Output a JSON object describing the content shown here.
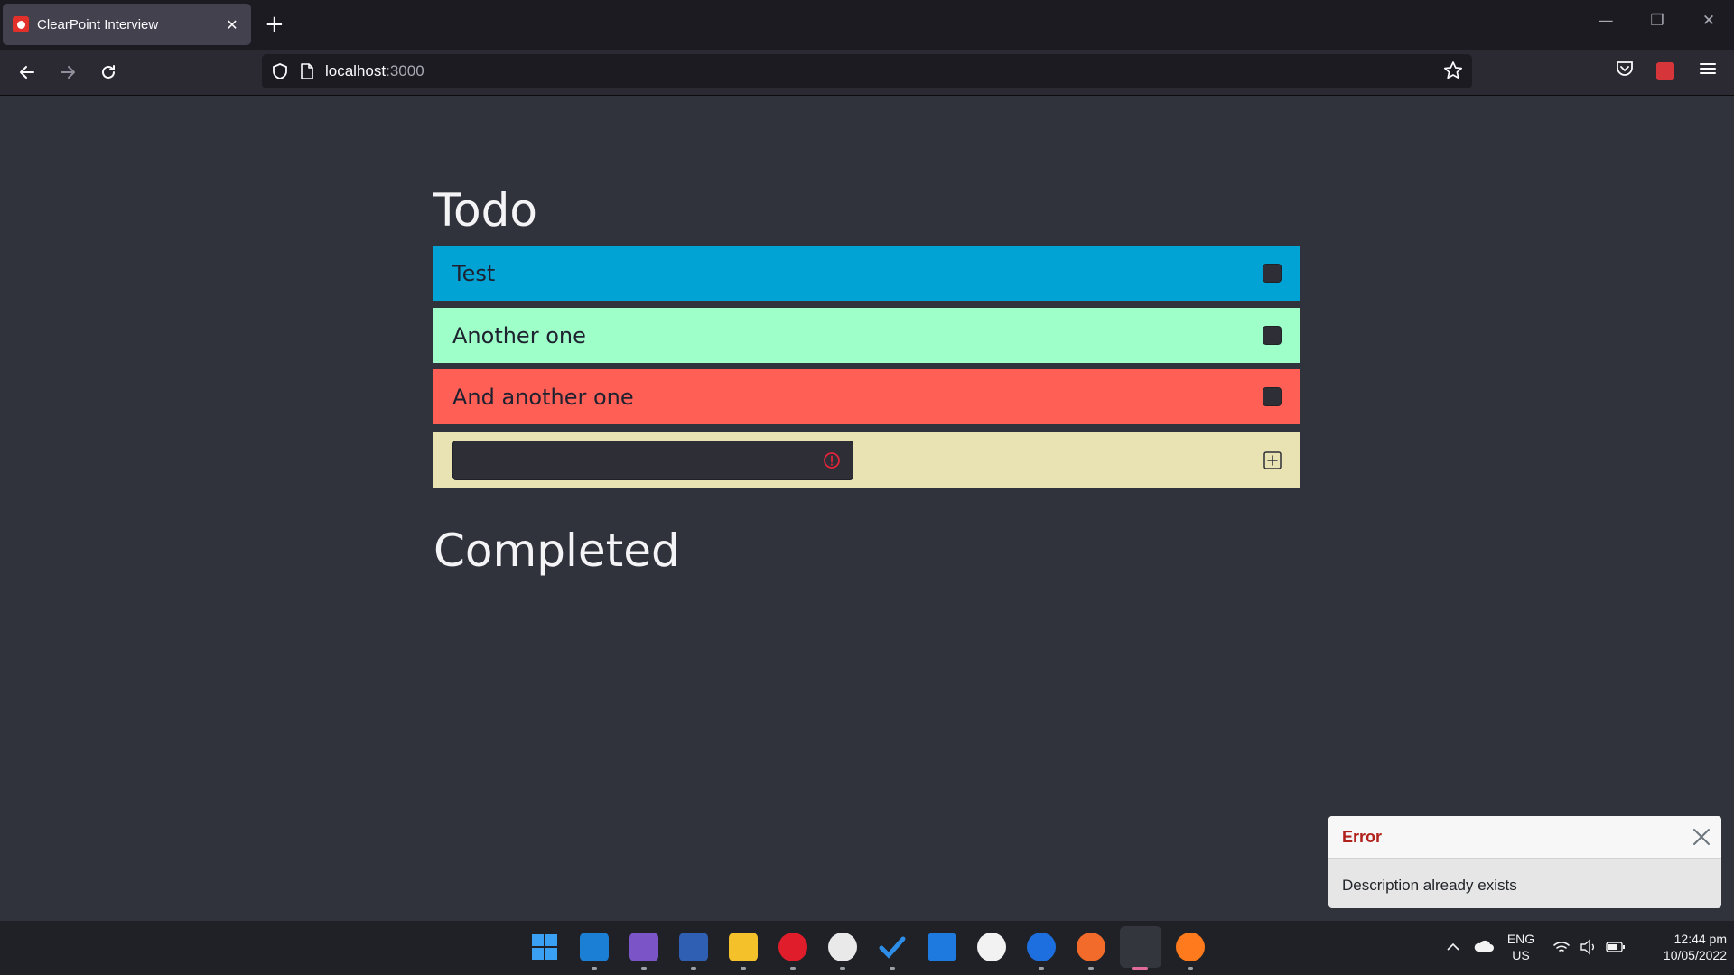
{
  "browser": {
    "tab_title": "ClearPoint Interview",
    "tab_close": "✕",
    "new_tab": "+",
    "url_host": "localhost",
    "url_port": ":3000",
    "window_controls": {
      "minimize": "—",
      "restore": "❐",
      "close": "✕"
    }
  },
  "app": {
    "todo_heading": "Todo",
    "completed_heading": "Completed",
    "items": [
      {
        "label": "Test",
        "color": "#00a3d3"
      },
      {
        "label": "Another one",
        "color": "#9effc8"
      },
      {
        "label": "And another one",
        "color": "#ff5f55"
      }
    ],
    "add_row_color": "#e9e2b2",
    "new_item_value": ""
  },
  "toast": {
    "title": "Error",
    "message": "Description already exists"
  },
  "taskbar": {
    "language": "ENG",
    "region": "US",
    "time": "12:44 pm",
    "date": "10/05/2022"
  }
}
